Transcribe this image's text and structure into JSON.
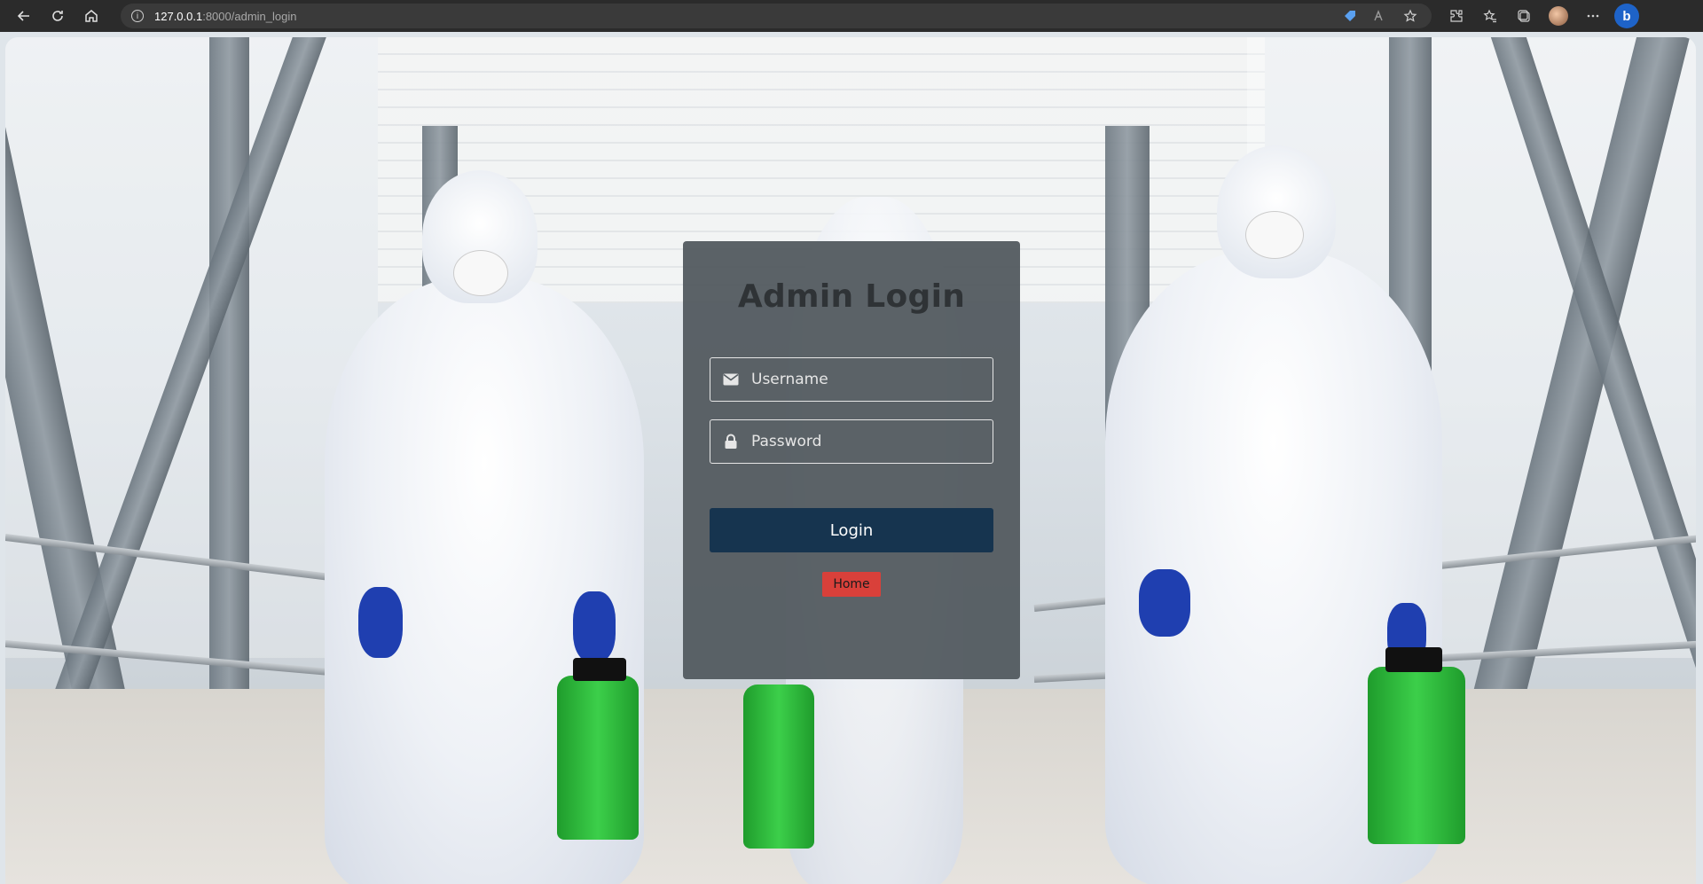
{
  "browser": {
    "url_host": "127.0.0.1",
    "url_path": ":8000/admin_login",
    "info_icon_glyph": "i",
    "bing_label": "b"
  },
  "login": {
    "title": "Admin Login",
    "username_placeholder": "Username",
    "password_placeholder": "Password",
    "login_label": "Login",
    "home_label": "Home"
  },
  "colors": {
    "card_bg": "#545c61",
    "login_button": "#16344f",
    "home_button": "#d9403a"
  },
  "icons": {
    "username": "envelope-icon",
    "password": "lock-icon"
  }
}
